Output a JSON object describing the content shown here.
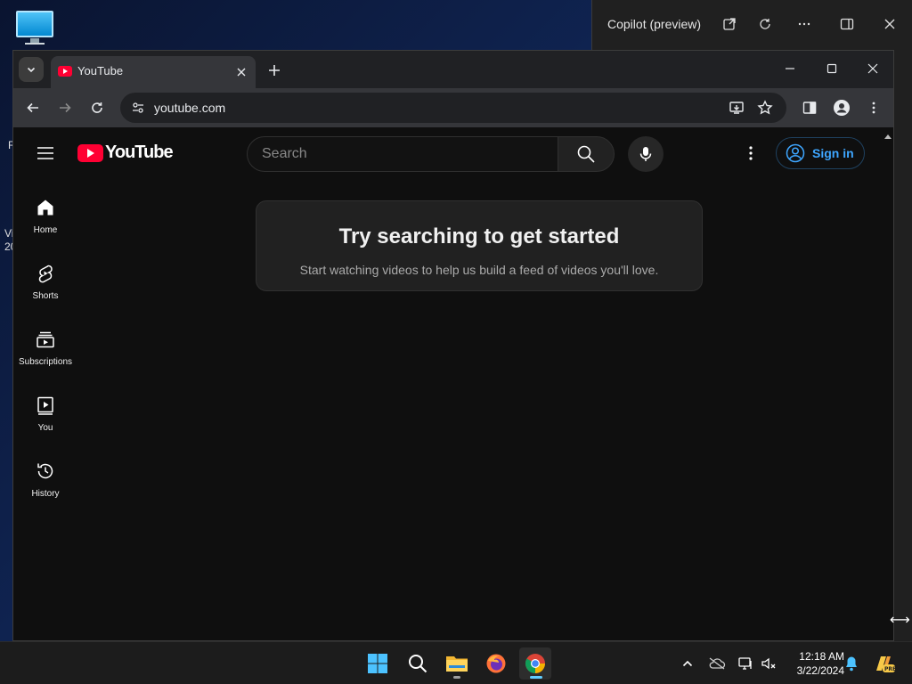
{
  "desktop": {
    "fragments": [
      "R",
      "Vi",
      "20"
    ]
  },
  "copilot": {
    "title": "Copilot (preview)"
  },
  "browser": {
    "tab": {
      "title": "YouTube"
    },
    "omnibox": {
      "url": "youtube.com"
    }
  },
  "youtube": {
    "logo_text": "YouTube",
    "search_placeholder": "Search",
    "sign_in": "Sign in",
    "sidebar": [
      {
        "label": "Home",
        "icon": "home-icon"
      },
      {
        "label": "Shorts",
        "icon": "shorts-icon"
      },
      {
        "label": "Subscriptions",
        "icon": "subscriptions-icon"
      },
      {
        "label": "You",
        "icon": "you-icon"
      },
      {
        "label": "History",
        "icon": "history-icon"
      }
    ],
    "empty_state": {
      "title": "Try searching to get started",
      "subtitle": "Start watching videos to help us build a feed of videos you'll love."
    }
  },
  "taskbar": {
    "time": "12:18 AM",
    "date": "3/22/2024"
  },
  "colors": {
    "youtube_red": "#ff0033",
    "link_blue": "#3ea6ff",
    "page_bg": "#0f0f0f"
  }
}
